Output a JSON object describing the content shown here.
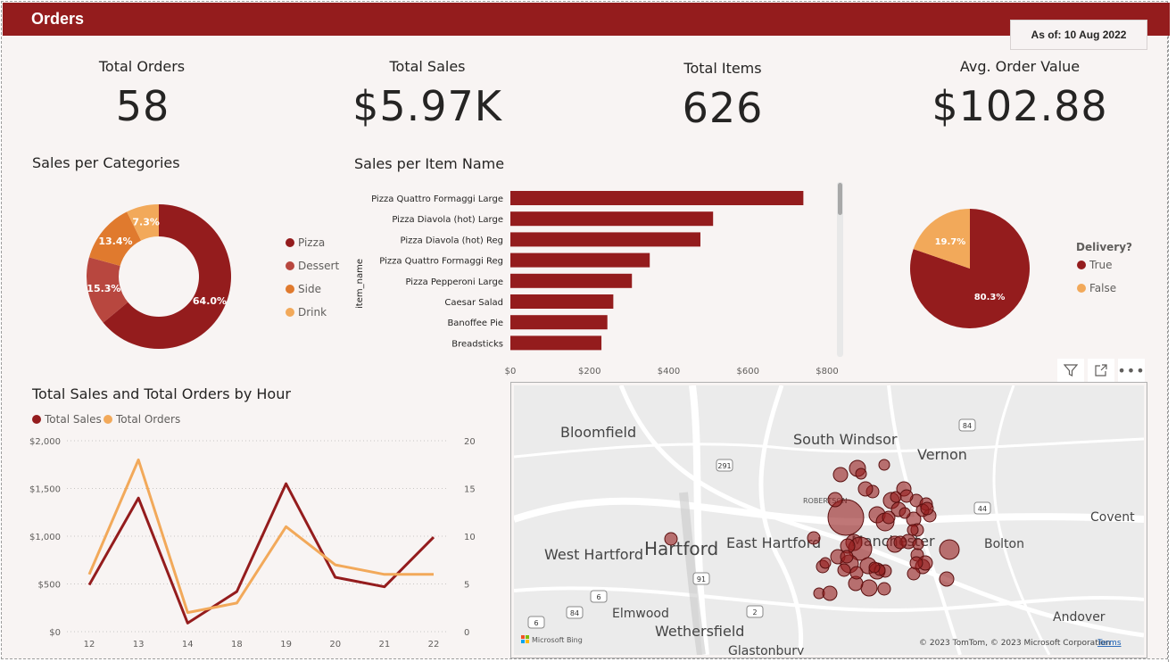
{
  "header": {
    "title": "Orders",
    "as_of": "As of: 10 Aug 2022"
  },
  "kpis": [
    {
      "label": "Total Orders",
      "value": "58"
    },
    {
      "label": "Total Sales",
      "value": "$5.97K"
    },
    {
      "label": "Total Items",
      "value": "626"
    },
    {
      "label": "Avg. Order Value",
      "value": "$102.88"
    }
  ],
  "colors": {
    "dark_red": "#941c1d",
    "mid_red": "#b8473f",
    "orange": "#e07a2e",
    "light_orange": "#f2a95a"
  },
  "donut": {
    "title": "Sales per Categories",
    "legend": [
      "Pizza",
      "Dessert",
      "Side",
      "Drink"
    ]
  },
  "bar": {
    "title": "Sales per Item Name",
    "ylabel": "item_name",
    "xticks": [
      "$0",
      "$200",
      "$400",
      "$600",
      "$800"
    ]
  },
  "pie": {
    "legend_title": "Delivery?",
    "legend": [
      "True",
      "False"
    ]
  },
  "line": {
    "title": "Total Sales and Total Orders by Hour",
    "legend": [
      "Total Sales",
      "Total Orders"
    ],
    "y_left_ticks": [
      "$2,000",
      "$1,500",
      "$1,000",
      "$500",
      "$0"
    ],
    "y_right_ticks": [
      "20",
      "15",
      "10",
      "5",
      "0"
    ]
  },
  "map": {
    "labels": {
      "bloomfield": "Bloomfield",
      "south_windsor": "South Windsor",
      "vernon": "Vernon",
      "robertson": "ROBERTSON",
      "hartford": "Hartford",
      "east_hartford": "East Hartford",
      "manchester": "Manchester",
      "west_hartford": "West Hartford",
      "bolton": "Bolton",
      "coventry": "Covent",
      "elmwood": "Elmwood",
      "wethersfield": "Wethersfield",
      "glastonbury": "Glastonbury",
      "andover": "Andover"
    },
    "route_labels": [
      "291",
      "84",
      "44",
      "91",
      "6",
      "84",
      "2",
      "6"
    ],
    "bing": "Microsoft Bing",
    "copyright": "© 2023 TomTom, © 2023 Microsoft Corporation",
    "terms": "Terms"
  },
  "chart_data": [
    {
      "type": "pie",
      "variant": "donut",
      "title": "Sales per Categories",
      "categories": [
        "Pizza",
        "Dessert",
        "Side",
        "Drink"
      ],
      "values": [
        64.0,
        15.3,
        13.4,
        7.3
      ],
      "labels": [
        "64.0%",
        "15.3%",
        "13.4%",
        "7.3%"
      ],
      "colors": [
        "#941c1d",
        "#b8473f",
        "#e07a2e",
        "#f2a95a"
      ],
      "legend": "right"
    },
    {
      "type": "bar",
      "orientation": "horizontal",
      "title": "Sales per Item Name",
      "ylabel": "item_name",
      "categories": [
        "Pizza Quattro Formaggi Large",
        "Pizza Diavola (hot) Large",
        "Pizza Diavola (hot) Reg",
        "Pizza Quattro Formaggi Reg",
        "Pizza Pepperoni Large",
        "Caesar Salad",
        "Banoffee Pie",
        "Breadsticks"
      ],
      "values": [
        740,
        512,
        480,
        352,
        307,
        260,
        245,
        230
      ],
      "xlim": [
        0,
        800
      ],
      "color": "#941c1d"
    },
    {
      "type": "pie",
      "title": "",
      "legend_title": "Delivery?",
      "categories": [
        "True",
        "False"
      ],
      "values": [
        80.3,
        19.7
      ],
      "labels": [
        "80.3%",
        "19.7%"
      ],
      "colors": [
        "#941c1d",
        "#f2a95a"
      ],
      "legend": "right"
    },
    {
      "type": "line",
      "title": "Total Sales and Total Orders by Hour",
      "x": [
        "12",
        "13",
        "14",
        "18",
        "19",
        "20",
        "21",
        "22"
      ],
      "series": [
        {
          "name": "Total Sales",
          "axis": "left",
          "values": [
            490,
            1400,
            90,
            420,
            1550,
            570,
            470,
            990
          ],
          "color": "#941c1d"
        },
        {
          "name": "Total Orders",
          "axis": "right",
          "values": [
            6,
            18,
            2,
            3,
            11,
            7,
            6,
            6
          ],
          "color": "#f2a95a"
        }
      ],
      "ylim_left": [
        0,
        2000
      ],
      "ylim_right": [
        0,
        20
      ],
      "legend": "top-left"
    }
  ]
}
